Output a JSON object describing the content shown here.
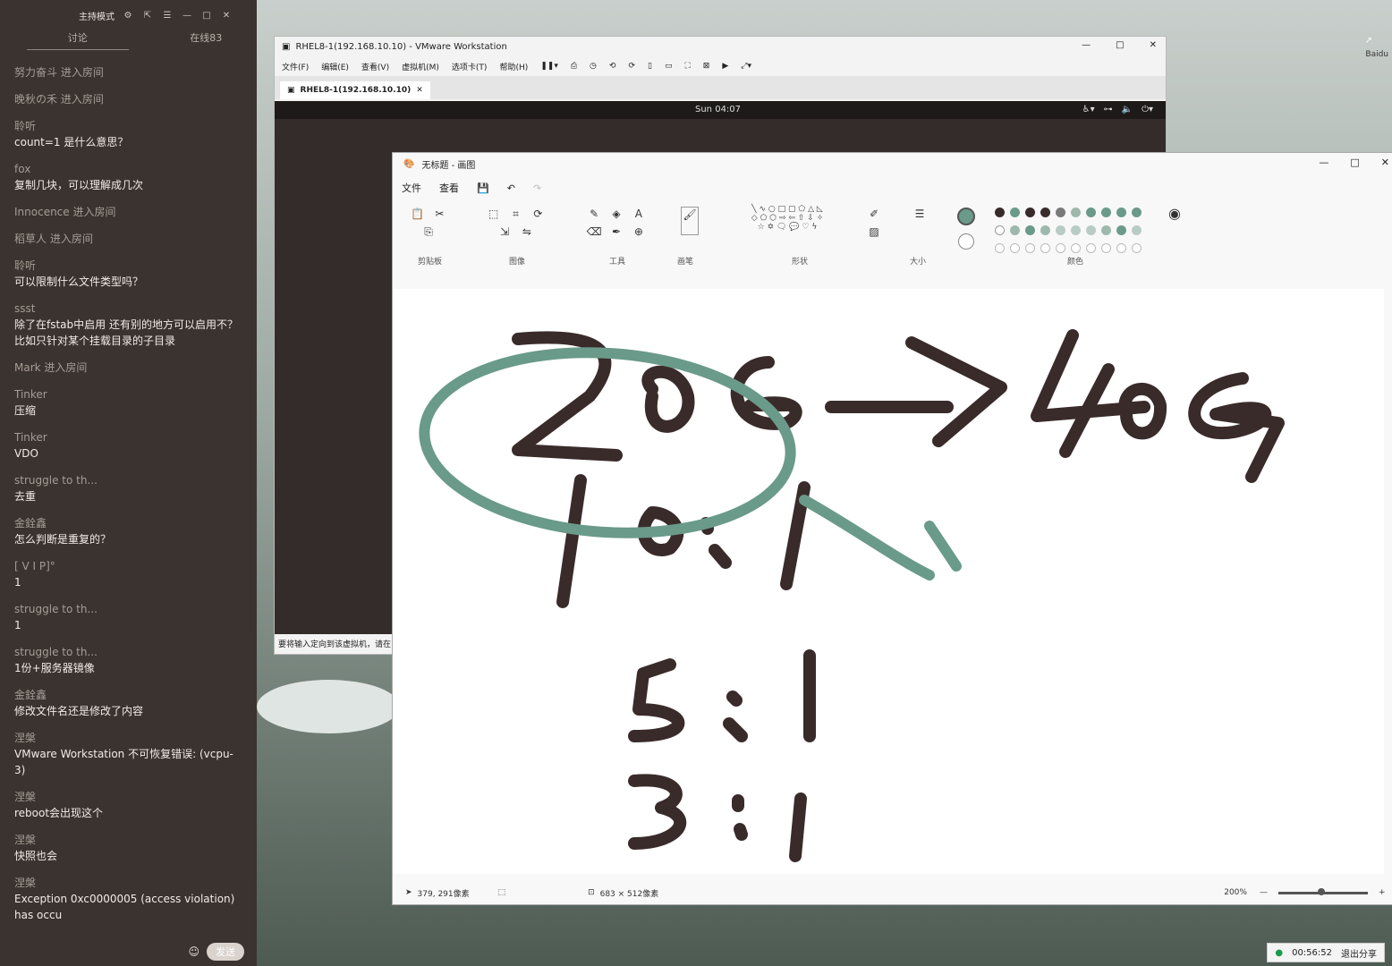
{
  "chat": {
    "mode_label": "主持模式",
    "tabs": [
      "讨论",
      "在线83"
    ],
    "messages": [
      {
        "type": "system",
        "text": "努力奋斗 进入房间"
      },
      {
        "type": "system",
        "text": "晚秋の禾 进入房间"
      },
      {
        "type": "msg",
        "name": "聆听",
        "text": "count=1 是什么意思？"
      },
      {
        "type": "msg",
        "name": "fox",
        "text": "复制几块，可以理解成几次"
      },
      {
        "type": "system",
        "text": "Innocence 进入房间"
      },
      {
        "type": "system",
        "text": "稻草人 进入房间"
      },
      {
        "type": "msg",
        "name": "聆听",
        "text": "可以限制什么文件类型吗？"
      },
      {
        "type": "msg",
        "name": "ssst",
        "text": "除了在fstab中启用 还有别的地方可以启用不？比如只针对某个挂载目录的子目录"
      },
      {
        "type": "system",
        "text": "Mark 进入房间"
      },
      {
        "type": "msg",
        "name": "Tinker",
        "text": "压缩"
      },
      {
        "type": "msg",
        "name": "Tinker",
        "text": "VDO"
      },
      {
        "type": "msg",
        "name": "struggle to th...",
        "text": "去重"
      },
      {
        "type": "msg",
        "name": "金銓鑫",
        "text": "怎么判断是重复的？"
      },
      {
        "type": "msg",
        "name": "[    V    I    P]°",
        "text": "1"
      },
      {
        "type": "msg",
        "name": "struggle to th...",
        "text": "1"
      },
      {
        "type": "msg",
        "name": "struggle to th...",
        "text": "1份+服务器镜像"
      },
      {
        "type": "msg",
        "name": "金銓鑫",
        "text": "修改文件名还是修改了内容"
      },
      {
        "type": "msg",
        "name": "涅槃",
        "text": "VMware Workstation 不可恢复错误: (vcpu-3)"
      },
      {
        "type": "msg",
        "name": "涅槃",
        "text": "reboot会出现这个"
      },
      {
        "type": "msg",
        "name": "涅槃",
        "text": "快照也会"
      },
      {
        "type": "msg",
        "name": "涅槃",
        "text": "Exception 0xc0000005 (access violation) has occu"
      }
    ],
    "send_label": "发送"
  },
  "vmware": {
    "title": "RHEL8-1(192.168.10.10) - VMware Workstation",
    "menu": [
      "文件(F)",
      "编辑(E)",
      "查看(V)",
      "虚拟机(M)",
      "选项卡(T)",
      "帮助(H)"
    ],
    "tab_label": "RHEL8-1(192.168.10.10)",
    "guest_clock": "Sun 04:07",
    "status_text": "要将输入定向到该虚拟机，请在"
  },
  "paint": {
    "title": "无标题 - 画图",
    "menu": [
      "文件",
      "查看"
    ],
    "groups": [
      "剪贴板",
      "图像",
      "工具",
      "画笔",
      "形状",
      "大小",
      "颜色"
    ],
    "cursor_pos": "379, 291像素",
    "canvas_size": "683 × 512像素",
    "zoom": "200%",
    "handwriting": [
      "20G",
      "→",
      "40G",
      "10:1",
      "5:1",
      "3:1"
    ],
    "palette_row1": [
      "#3a2b2b",
      "#6a9a8a",
      "#3a2b2b",
      "#3a2b2b",
      "#7a7a7a",
      "#9fb8ae",
      "#6a9a8a",
      "#6a9a8a",
      "#6a9a8a",
      "#6a9a8a"
    ],
    "palette_row2": [
      "#ffffff",
      "#9fb8ae",
      "#6a9a8a",
      "#9fb8ae",
      "#b8cbc4",
      "#b8cbc4",
      "#b8cbc4",
      "#9fb8ae",
      "#6a9a8a",
      "#b8cbc4"
    ],
    "primary_color": "#6a9a8a",
    "ink_color": "#3a2b2b"
  },
  "recorder": {
    "time": "00:56:52",
    "exit_label": "退出分享"
  },
  "edge_label": "Baidu"
}
